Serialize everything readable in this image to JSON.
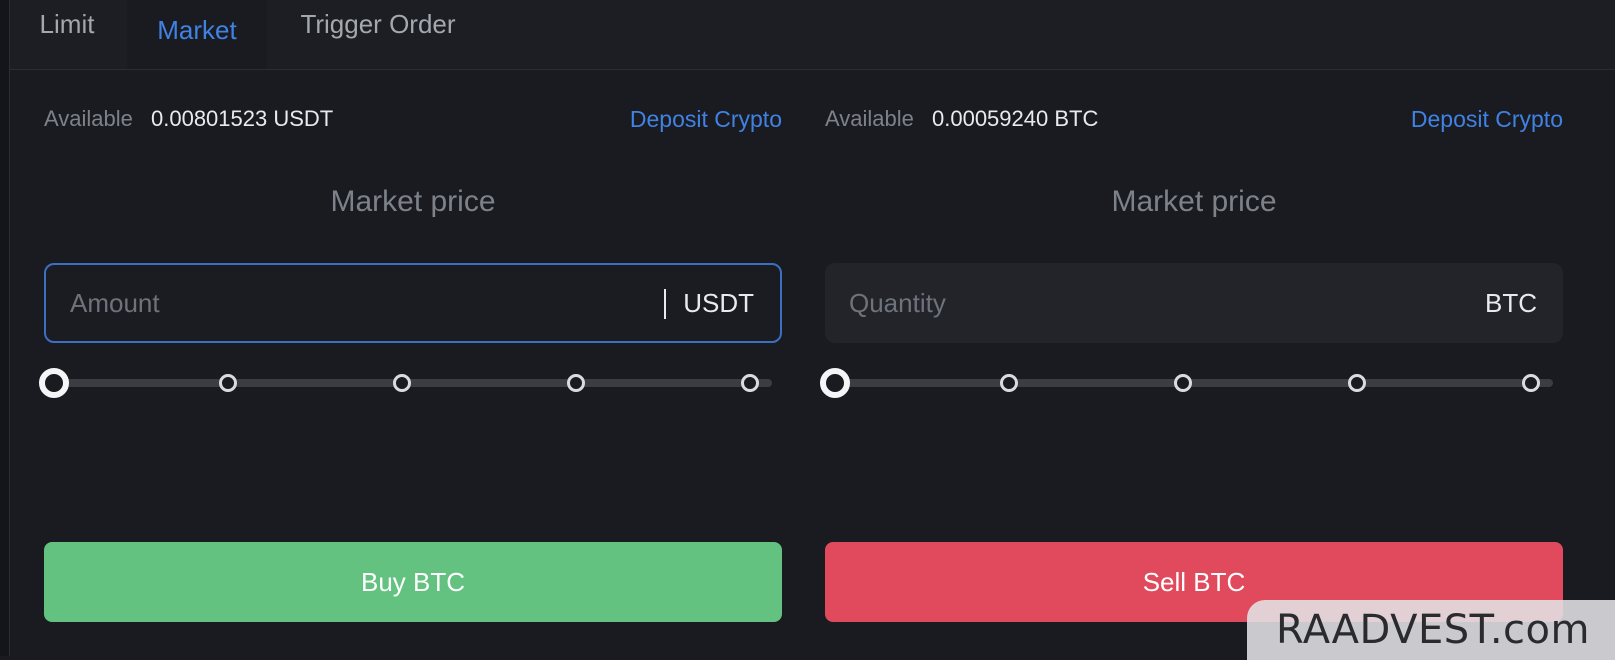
{
  "tabs": [
    {
      "label": "Limit",
      "active": false
    },
    {
      "label": "Market",
      "active": true
    },
    {
      "label": "Trigger Order",
      "active": false
    }
  ],
  "buy_panel": {
    "available_label": "Available",
    "available_value": "0.00801523 USDT",
    "deposit_label": "Deposit Crypto",
    "price_label": "Market price",
    "input_placeholder": "Amount",
    "input_value": "",
    "input_unit": "USDT",
    "slider_percent": 0,
    "action_label": "Buy BTC"
  },
  "sell_panel": {
    "available_label": "Available",
    "available_value": "0.00059240 BTC",
    "deposit_label": "Deposit Crypto",
    "price_label": "Market price",
    "input_placeholder": "Quantity",
    "input_value": "",
    "input_unit": "BTC",
    "slider_percent": 0,
    "action_label": "Sell BTC"
  },
  "colors": {
    "accent": "#3f82e3",
    "buy": "#63c27f",
    "sell": "#e04a5c",
    "background": "#1a1b20"
  },
  "watermark": "RAADVEST.com"
}
